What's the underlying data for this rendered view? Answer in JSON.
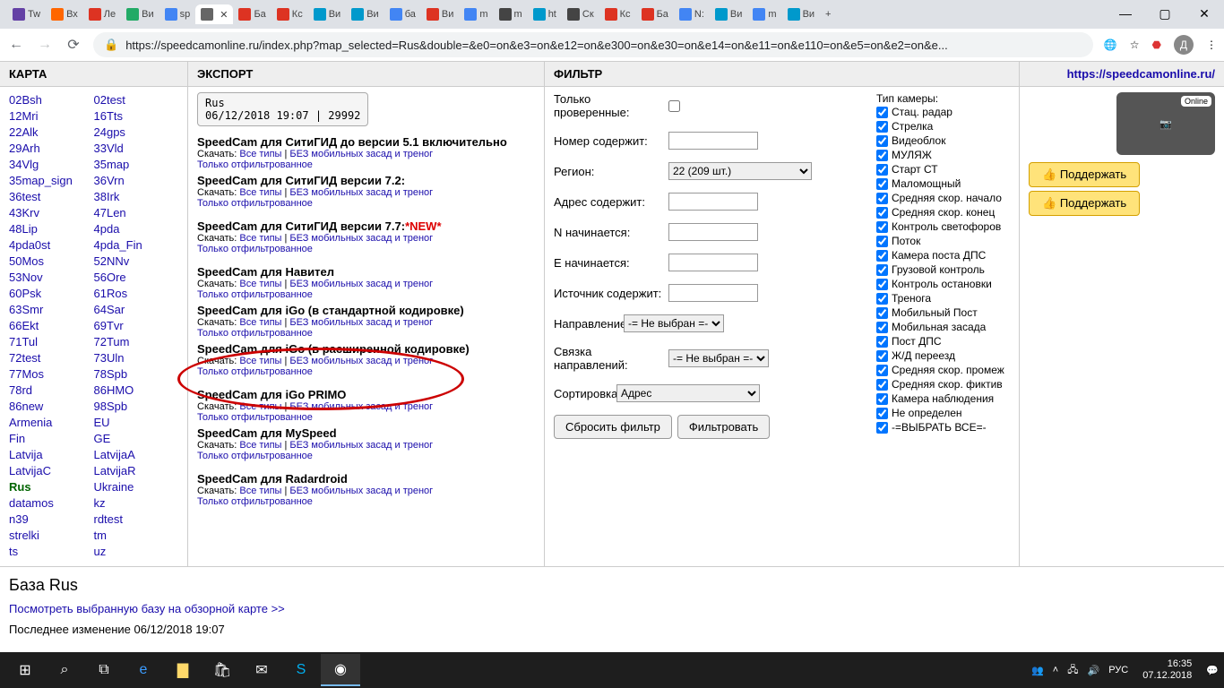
{
  "browser": {
    "tabs": [
      "Tw",
      "Вх",
      "Ле",
      "Ви",
      "sp",
      "",
      "Ба",
      "Кс",
      "Ви",
      "Ви",
      "ба",
      "Ви",
      "m",
      "m",
      "ht",
      "Ск",
      "Кс",
      "Ба",
      "N:",
      "Ви",
      "m",
      "Ви"
    ],
    "url": "https://speedcamonline.ru/index.php?map_selected=Rus&double=&e0=on&e3=on&e12=on&e300=on&e30=on&e14=on&e11=on&e110=on&e5=on&e2=on&e..."
  },
  "headers": {
    "map": "КАРТА",
    "export": "ЭКСПОРТ",
    "filter": "ФИЛЬТР",
    "right_link": "https://speedcamonline.ru/"
  },
  "map_col1": [
    "02Bsh",
    "12Mri",
    "22Alk",
    "29Arh",
    "34Vlg",
    "35map_sign",
    "36test",
    "43Krv",
    "48Lip",
    "4pda0st",
    "50Mos",
    "53Nov",
    "60Psk",
    "63Smr",
    "66Ekt",
    "71Tul",
    "72test",
    "77Mos",
    "78rd",
    "86new",
    "Armenia",
    "Fin",
    "Latvija",
    "LatvijaC",
    "Rus",
    "datamos",
    "n39",
    "strelki",
    "ts"
  ],
  "map_col2": [
    "02test",
    "16Tts",
    "24gps",
    "33Vld",
    "35map",
    "36Vrn",
    "38Irk",
    "47Len",
    "4pda",
    "4pda_Fin",
    "52NNv",
    "56Ore",
    "61Ros",
    "64Sar",
    "69Tvr",
    "72Tum",
    "73Uln",
    "78Spb",
    "86HMO",
    "98Spb",
    "EU",
    "GE",
    "LatvijaA",
    "LatvijaR",
    "Ukraine",
    "kz",
    "rdtest",
    "tm",
    "uz"
  ],
  "export_status": {
    "line1": "Rus",
    "line2": "06/12/2018 19:07 | 29992"
  },
  "exports": [
    {
      "title": "SpeedCam для СитиГИД до версии 5.1 включительно",
      "new": false
    },
    {
      "title": "SpeedCam для СитиГИД версии 7.2:",
      "new": false
    },
    {
      "title": "SpeedCam для СитиГИД версии 7.7:",
      "new": true
    },
    {
      "title": "SpeedCam для Навител",
      "new": false
    },
    {
      "title": "SpeedCam для iGo (в стандартной кодировке)",
      "new": false
    },
    {
      "title": "SpeedCam для iGo (в расширенной кодировке)",
      "new": false
    },
    {
      "title": "SpeedCam для iGo PRIMO",
      "new": false
    },
    {
      "title": "SpeedCam для MySpeed",
      "new": false
    },
    {
      "title": "SpeedCam для Radardroid",
      "new": false
    }
  ],
  "export_labels": {
    "dl": "Скачать:",
    "all": "Все типы",
    "no_mob": "БЕЗ мобильных засад и треног",
    "filtered": "Только отфильтрованное",
    "new": "*NEW*"
  },
  "filter": {
    "rows": {
      "verified": "Только проверенные:",
      "number": "Номер содержит:",
      "region": "Регион:",
      "region_val": "22 (209 шт.)",
      "address": "Адрес содержит:",
      "n_starts": "N начинается:",
      "e_starts": "E начинается:",
      "source": "Источник содержит:",
      "direction": "Направление:",
      "direction_val": "-= Не выбран =-",
      "dir_bundle": "Связка направлений:",
      "dir_bundle_val": "-= Не выбран =-",
      "sort": "Сортировка:",
      "sort_val": "Адрес"
    },
    "reset_btn": "Сбросить фильтр",
    "apply_btn": "Фильтровать"
  },
  "cam_header": "Тип камеры:",
  "cam_types": [
    "Стац. радар",
    "Стрелка",
    "Видеоблок",
    "МУЛЯЖ",
    "Старт СТ",
    "Маломощный",
    "Средняя скор. начало",
    "Средняя скор. конец",
    "Контроль светофоров",
    "Поток",
    "Камера поста ДПС",
    "Грузовой контроль",
    "Контроль остановки",
    "Тренога",
    "Мобильный Пост",
    "Мобильная засада",
    "Пост ДПС",
    "Ж/Д переезд",
    "Средняя скор. промеж",
    "Средняя скор. фиктив",
    "Камера наблюдения",
    "Не определен",
    "-=ВЫБРАТЬ ВСЕ=-"
  ],
  "right": {
    "support": "Поддержать",
    "logo": "Online"
  },
  "bottom": {
    "title": "База Rus",
    "link": "Посмотреть выбранную базу на обзорной карте >>",
    "meta": "Последнее изменение 06/12/2018 19:07"
  },
  "taskbar": {
    "lang": "РУС",
    "time": "16:35",
    "date": "07.12.2018"
  }
}
